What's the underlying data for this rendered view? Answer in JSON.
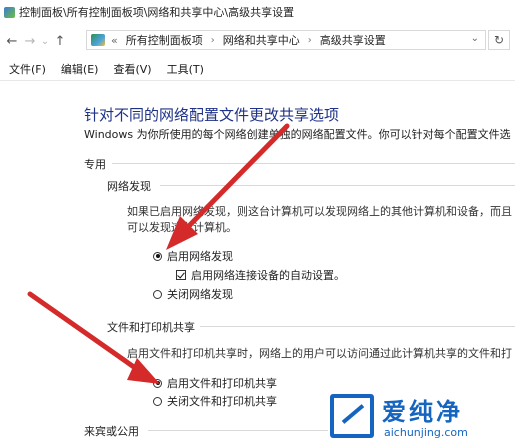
{
  "window": {
    "title": "控制面板\\所有控制面板项\\网络和共享中心\\高级共享设置"
  },
  "nav": {
    "back": "←",
    "forward": "→",
    "dropdown": "⌄",
    "up": "↑",
    "breadcrumb_prefix": "«",
    "breadcrumb": [
      "所有控制面板项",
      "网络和共享中心",
      "高级共享设置"
    ],
    "refresh": "↻",
    "separator": "›"
  },
  "menu": [
    "文件(F)",
    "编辑(E)",
    "查看(V)",
    "工具(T)"
  ],
  "main": {
    "heading": "针对不同的网络配置文件更改共享选项",
    "description": "Windows 为你所使用的每个网络创建单独的网络配置文件。你可以针对每个配置文件选",
    "profile_private": "专用",
    "network_discovery": {
      "title": "网络发现",
      "desc_line1": "如果已启用网络发现，则这台计算机可以发现网络上的其他计算机和设备，而且",
      "desc_line2": "可以发现这台计算机。",
      "option_on": "启用网络发现",
      "auto_setup": "启用网络连接设备的自动设置。",
      "option_off": "关闭网络发现",
      "selected": "on",
      "auto_setup_checked": true
    },
    "file_printer_sharing": {
      "title": "文件和打印机共享",
      "desc_line1": "启用文件和打印机共享时，网络上的用户可以访问通过此计算机共享的文件和打",
      "option_on": "启用文件和打印机共享",
      "option_off": "关闭文件和打印机共享",
      "selected": "on"
    },
    "profile_guest": "来宾或公用"
  },
  "watermark": {
    "name": "爱纯净",
    "url": "aichunjing.com"
  },
  "colors": {
    "heading": "#1e3287",
    "arrow": "#d42a2a",
    "watermark": "#1565c0"
  }
}
